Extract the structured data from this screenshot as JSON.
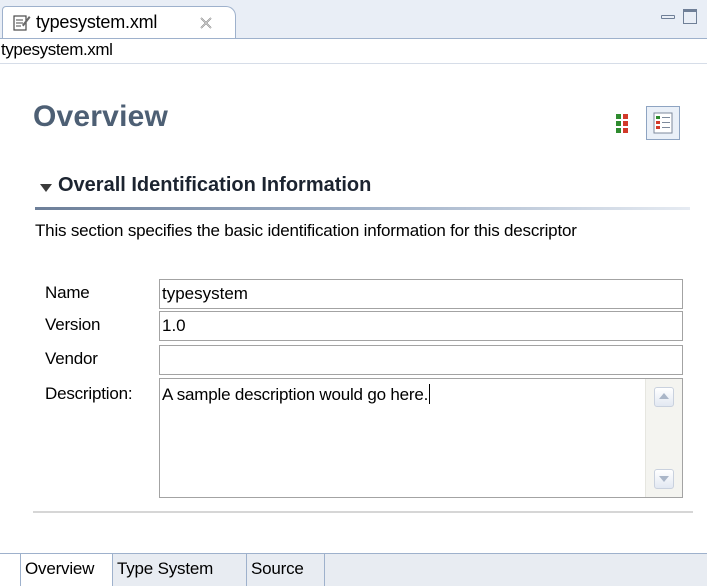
{
  "editor_tab": {
    "label": "typesystem.xml",
    "icon": "xml-edit-icon"
  },
  "window_controls": {
    "minimize": "minimize-icon",
    "maximize": "maximize-icon"
  },
  "file_header": {
    "label": "typesystem.xml"
  },
  "form": {
    "title": "Overview"
  },
  "section": {
    "title": "Overall Identification Information",
    "description": "This section specifies the basic identification information for this descriptor",
    "fields": {
      "name_label": "Name",
      "name_value": "typesystem",
      "version_label": "Version",
      "version_value": "1.0",
      "vendor_label": "Vendor",
      "vendor_value": "",
      "description_label": "Description:",
      "description_value": "A sample description would go here."
    }
  },
  "page_tabs": [
    {
      "label": "Overview",
      "active": true
    },
    {
      "label": "Type System",
      "active": false
    },
    {
      "label": "Source",
      "active": false
    }
  ],
  "colors": {
    "title": "#4d5f74",
    "tab_border": "#9eb1cc",
    "accent": "#6d7f99"
  }
}
